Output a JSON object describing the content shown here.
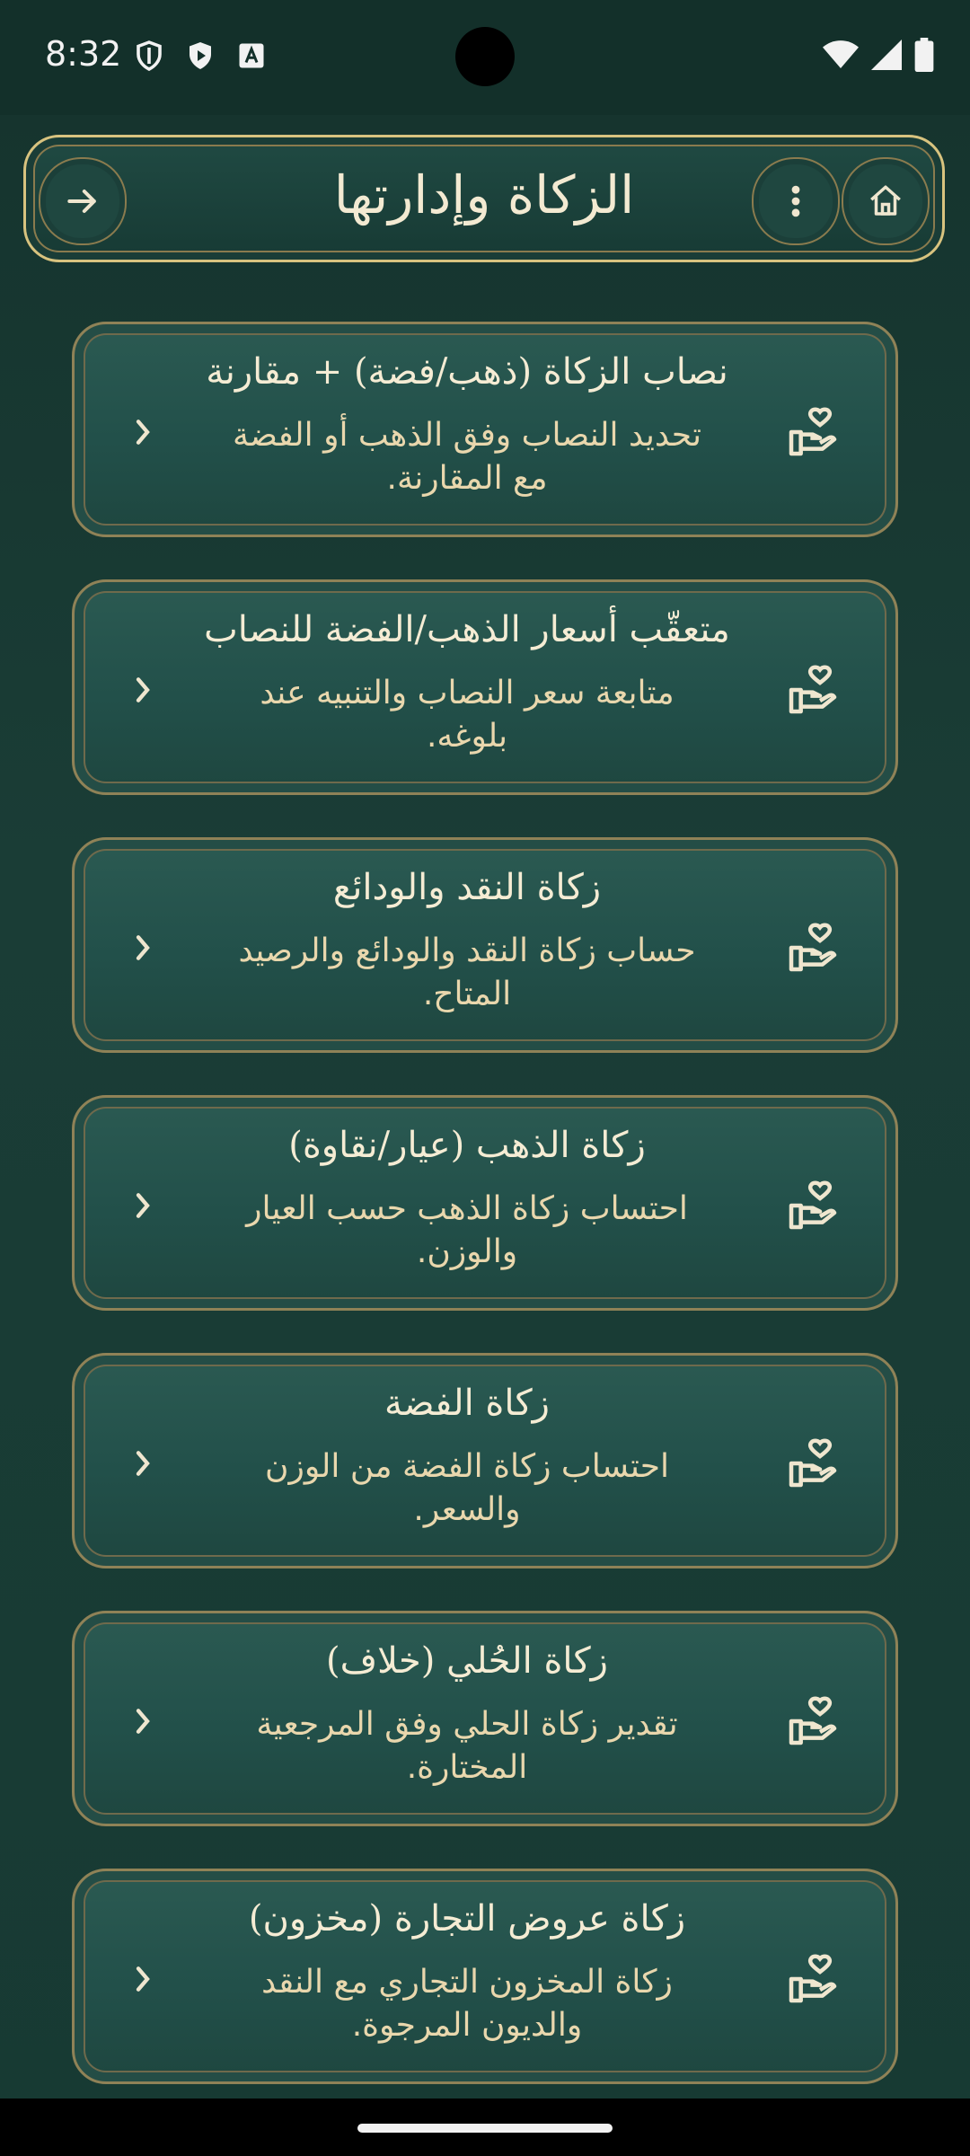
{
  "status_bar": {
    "time": "8:32"
  },
  "header": {
    "title": "الزكاة وإدارتها"
  },
  "cards": [
    {
      "title": "نصاب الزكاة (ذهب/فضة) + مقارنة",
      "desc_line1": "تحديد النصاب وفق الذهب أو الفضة",
      "desc_line2": "مع المقارنة."
    },
    {
      "title": "متعقّب أسعار الذهب/الفضة للنصاب",
      "desc_line1": "متابعة سعر النصاب والتنبيه عند",
      "desc_line2": "بلوغه."
    },
    {
      "title": "زكاة النقد والودائع",
      "desc_line1": "حساب زكاة النقد والودائع والرصيد",
      "desc_line2": "المتاح."
    },
    {
      "title": "زكاة الذهب (عيار/نقاوة)",
      "desc_line1": "احتساب زكاة الذهب حسب العيار",
      "desc_line2": "والوزن."
    },
    {
      "title": "زكاة الفضة",
      "desc_line1": "احتساب زكاة الفضة من الوزن",
      "desc_line2": "والسعر."
    },
    {
      "title": "زكاة الحُلي (خلاف)",
      "desc_line1": "تقدير زكاة الحلي وفق المرجعية",
      "desc_line2": "المختارة."
    },
    {
      "title": "زكاة عروض التجارة (مخزون)",
      "desc_line1": "زكاة المخزون التجاري مع النقد",
      "desc_line2": "والديون المرجوة."
    }
  ]
}
